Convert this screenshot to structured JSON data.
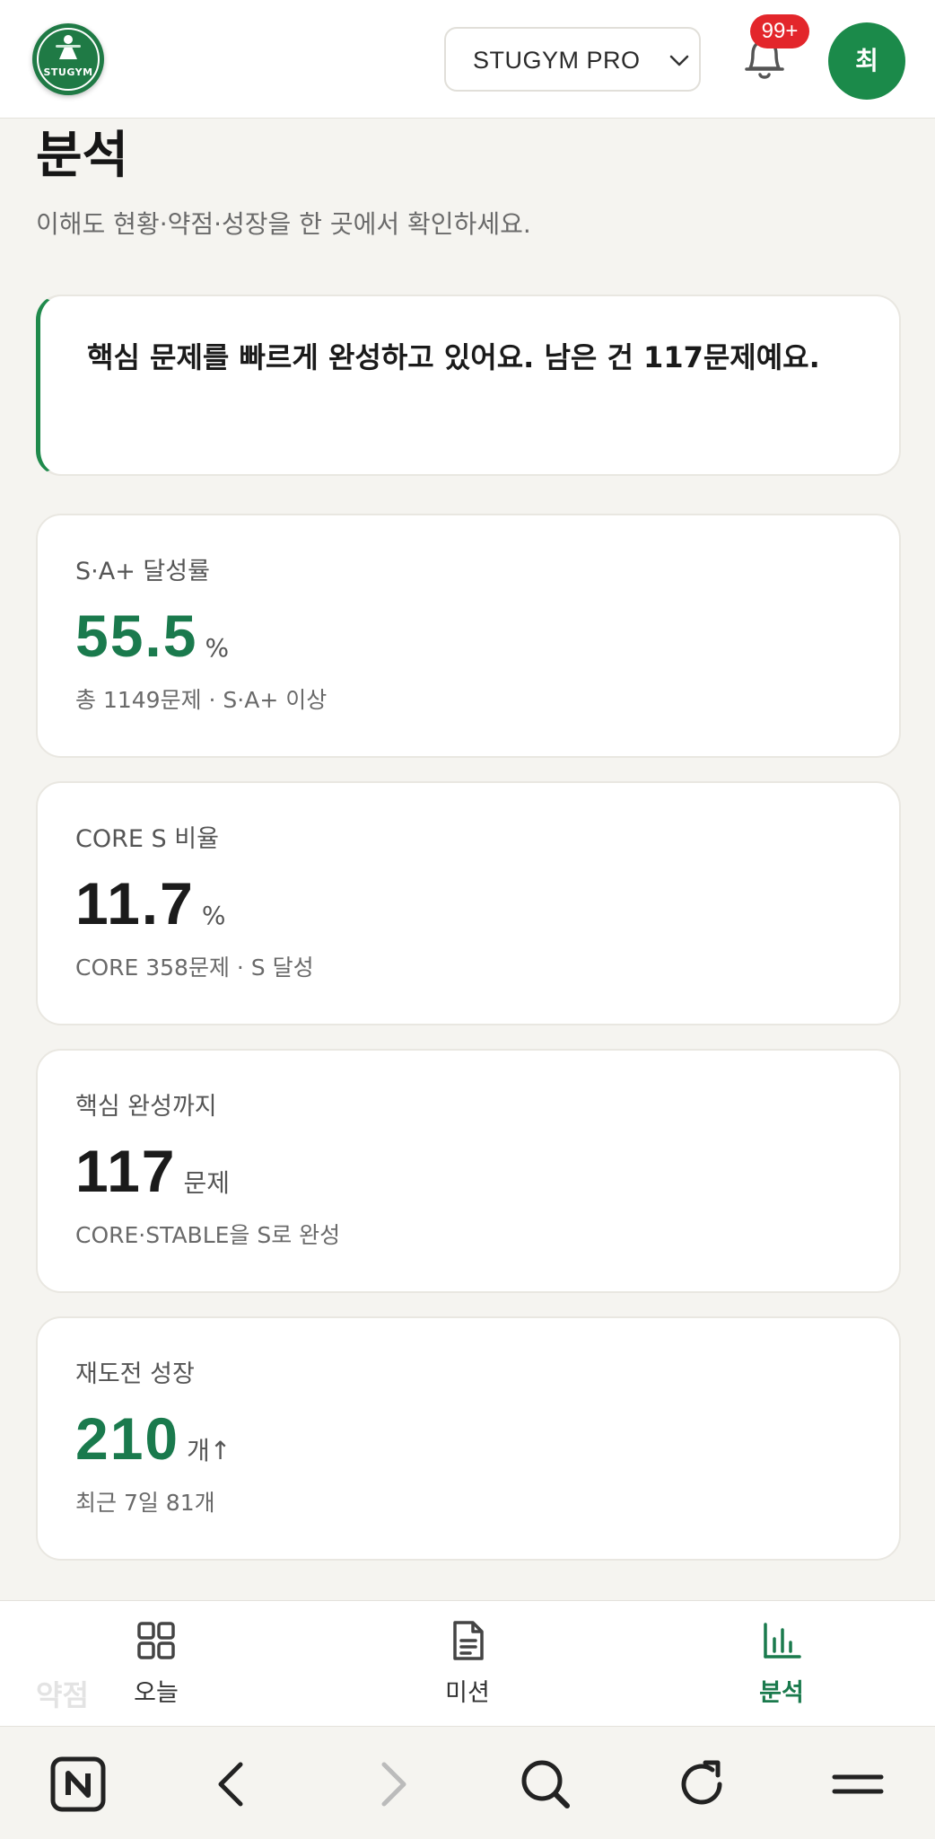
{
  "header": {
    "logo_text": "STUGYM",
    "selector_label": "STUGYM PRO",
    "notification_badge": "99+",
    "avatar_initial": "최"
  },
  "page": {
    "title": "분석",
    "subtitle": "이해도 현황·약점·성장을 한 곳에서 확인하세요."
  },
  "banner": {
    "text": "핵심 문제를 빠르게 완성하고 있어요. 남은 건 117문제예요."
  },
  "stats": [
    {
      "label": "S·A+ 달성률",
      "value": "55.5",
      "unit": "%",
      "sub": "총 1149문제 · S·A+ 이상",
      "highlight": true
    },
    {
      "label": "CORE S 비율",
      "value": "11.7",
      "unit": "%",
      "sub": "CORE 358문제 · S 달성",
      "highlight": false
    },
    {
      "label": "핵심 완성까지",
      "value": "117",
      "unit": "문제",
      "sub": "CORE·STABLE을 S로 완성",
      "highlight": false
    },
    {
      "label": "재도전 성장",
      "value": "210",
      "unit": "개↑",
      "sub": "최근 7일 81개",
      "highlight": true
    }
  ],
  "peek_section_title": "약점",
  "bottom_nav": {
    "items": [
      {
        "label": "오늘",
        "icon": "grid-icon",
        "active": false
      },
      {
        "label": "미션",
        "icon": "document-icon",
        "active": false
      },
      {
        "label": "분석",
        "icon": "bar-chart-icon",
        "active": true
      }
    ]
  },
  "browser_bar": {
    "icons": [
      "naver-n-icon",
      "back-icon",
      "forward-icon",
      "search-icon",
      "reload-icon",
      "menu-icon"
    ]
  },
  "colors": {
    "accent_green": "#1a7a4d",
    "avatar_green": "#1b8a4a",
    "badge_red": "#e3262b",
    "background": "#f5f4f0"
  }
}
